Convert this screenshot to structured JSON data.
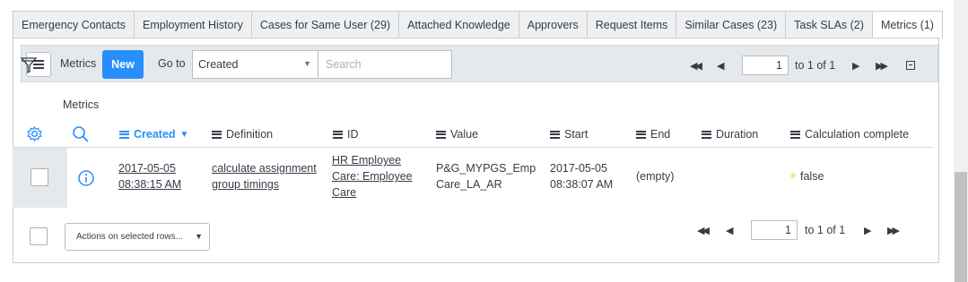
{
  "tabs": [
    {
      "label": "Emergency Contacts"
    },
    {
      "label": "Employment History"
    },
    {
      "label": "Cases for Same User (29)"
    },
    {
      "label": "Attached Knowledge"
    },
    {
      "label": "Approvers"
    },
    {
      "label": "Request Items"
    },
    {
      "label": "Similar Cases (23)"
    },
    {
      "label": "Task SLAs (2)"
    },
    {
      "label": "Metrics (1)"
    }
  ],
  "toolbar": {
    "title": "Metrics",
    "new_label": "New",
    "goto_label": "Go to",
    "goto_field": "Created",
    "search_placeholder": "Search"
  },
  "pager_top": {
    "page": "1",
    "of_text": "to 1 of 1"
  },
  "breadcrumb": "Metrics",
  "columns": {
    "created": "Created",
    "definition": "Definition",
    "id": "ID",
    "value": "Value",
    "start": "Start",
    "end": "End",
    "duration": "Duration",
    "calc": "Calculation complete"
  },
  "row": {
    "created_1": "2017-05-05",
    "created_2": "08:38:15 AM",
    "definition_1": "calculate assignment",
    "definition_2": "group timings",
    "id_1": "HR Employee",
    "id_2": "Care: Employee",
    "id_3": "Care",
    "value_1": "P&G_MYPGS_Emp",
    "value_2": "Care_LA_AR",
    "start_1": "2017-05-05",
    "start_2": "08:38:07 AM",
    "end": "(empty)",
    "duration": "",
    "calc": "false"
  },
  "footer": {
    "actions_label": "Actions on selected rows...",
    "page": "1",
    "of_text": "to 1 of 1"
  },
  "colors": {
    "accent": "#278efc",
    "toolbar_bg": "#e6e9eb"
  }
}
